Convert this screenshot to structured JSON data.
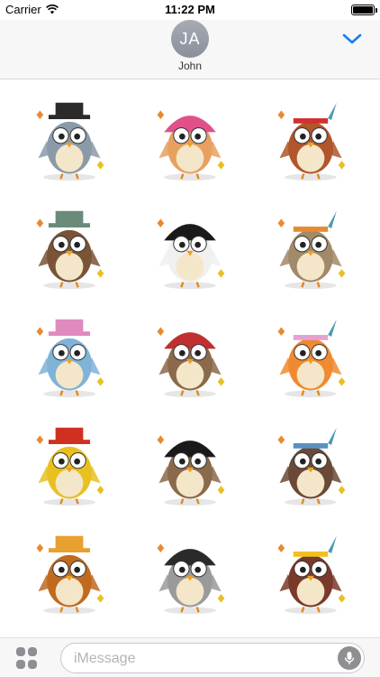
{
  "status_bar": {
    "carrier": "Carrier",
    "time": "11:22 PM"
  },
  "header": {
    "avatar_initials": "JA",
    "contact_name": "John"
  },
  "stickers": [
    {
      "name": "pilgrim-owl-corn",
      "body": "#8a9aa8",
      "accent": "#2b2b2b"
    },
    {
      "name": "turkey-owl-pie",
      "body": "#e8a060",
      "accent": "#e0508a"
    },
    {
      "name": "native-owl-drum",
      "body": "#b0562a",
      "accent": "#d03030"
    },
    {
      "name": "log-cabin-owl",
      "body": "#7a5436",
      "accent": "#6a8a7a"
    },
    {
      "name": "pilgrim-owl-buckle-hat",
      "body": "#f0f0f0",
      "accent": "#1a1a1a"
    },
    {
      "name": "pilgrim-owl-pumpkin",
      "body": "#a08a6a",
      "accent": "#e88a30"
    },
    {
      "name": "owl-bonnet-branch",
      "body": "#7fb3d8",
      "accent": "#e08bbf"
    },
    {
      "name": "native-owl-barrel",
      "body": "#8a6a4a",
      "accent": "#c03030"
    },
    {
      "name": "helmet-owl",
      "body": "#f08a30",
      "accent": "#e8a0d0"
    },
    {
      "name": "chief-owl-headdress",
      "body": "#e8c020",
      "accent": "#d03020"
    },
    {
      "name": "pilgrim-owl-blunderbuss",
      "body": "#8a6a4a",
      "accent": "#1a1a1a"
    },
    {
      "name": "teepee-owl",
      "body": "#6a4a36",
      "accent": "#5a90c0"
    },
    {
      "name": "native-owl-stump",
      "body": "#c06a20",
      "accent": "#e8a030"
    },
    {
      "name": "pilgrim-owl-pitchfork",
      "body": "#9a9a9a",
      "accent": "#2a2a2a"
    },
    {
      "name": "turkey-owl-bow",
      "body": "#7a3a2a",
      "accent": "#f0c020"
    }
  ],
  "input_bar": {
    "placeholder": "iMessage"
  },
  "colors": {
    "accent_blue": "#1a7cf0",
    "avatar_gray": "#9aa0a8"
  }
}
